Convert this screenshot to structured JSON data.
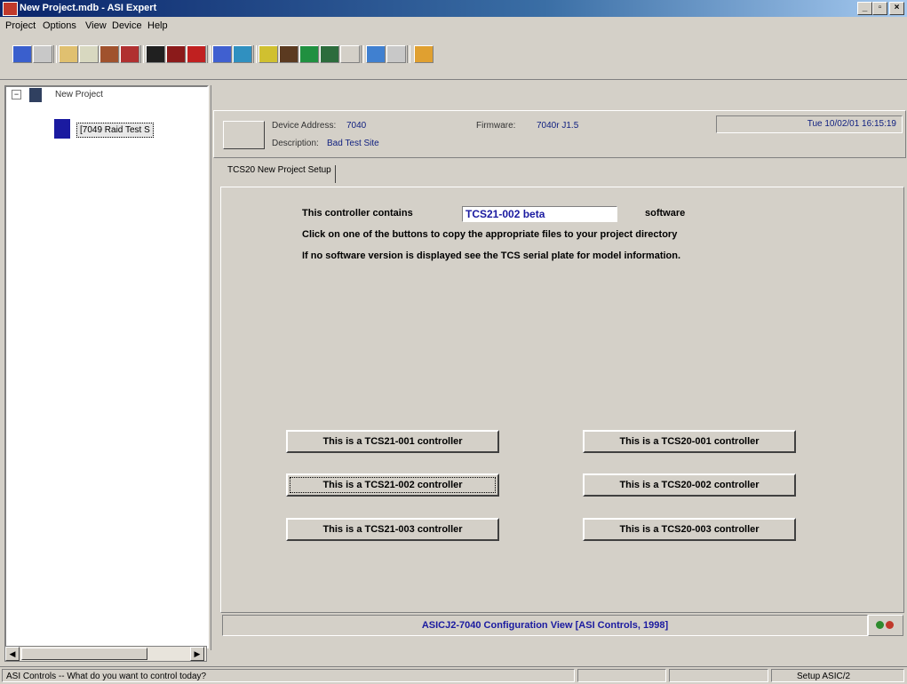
{
  "window": {
    "title": "New Project.mdb - ASI Expert",
    "minimize": "_",
    "maximize": "▫",
    "close": "×"
  },
  "menu": [
    "Project",
    "Options",
    "View",
    "Device",
    "Help"
  ],
  "tree": {
    "root": "New Project",
    "child": "[7049 Raid Test S"
  },
  "header": {
    "device_address_label": "Device Address:",
    "device_address": "7040",
    "firmware_label": "Firmware:",
    "firmware": "7040r J1.5",
    "description_label": "Description:",
    "description": "Bad Test Site",
    "datetime": "Tue 10/02/01 16:15:19"
  },
  "tab": "TCS20 New Project Setup",
  "content": {
    "contains_prefix": "This controller contains",
    "software_value": "TCS21-002 beta",
    "contains_suffix": "software",
    "line2": "Click on one of the buttons to copy the appropriate files to your project directory",
    "line3": "If no software version is displayed see the TCS serial plate for model information."
  },
  "buttons": {
    "tcs21_001": "This is a TCS21-001 controller",
    "tcs21_002": "This is a TCS21-002 controller",
    "tcs21_003": "This is a TCS21-003 controller",
    "tcs20_001": "This is a TCS20-001 controller",
    "tcs20_002": "This is a TCS20-002 controller",
    "tcs20_003": "This is a TCS20-003 controller"
  },
  "footer": "ASICJ2-7040 Configuration View [ASI Controls, 1998]",
  "status": {
    "left": "ASI Controls -- What do you want to control today?",
    "right": "Setup ASIC/2"
  },
  "colors": {
    "title_gradient_start": "#0a246a",
    "accent_blue": "#1a1aa0",
    "led_green": "#2e8b2e",
    "led_red": "#c0392b"
  }
}
